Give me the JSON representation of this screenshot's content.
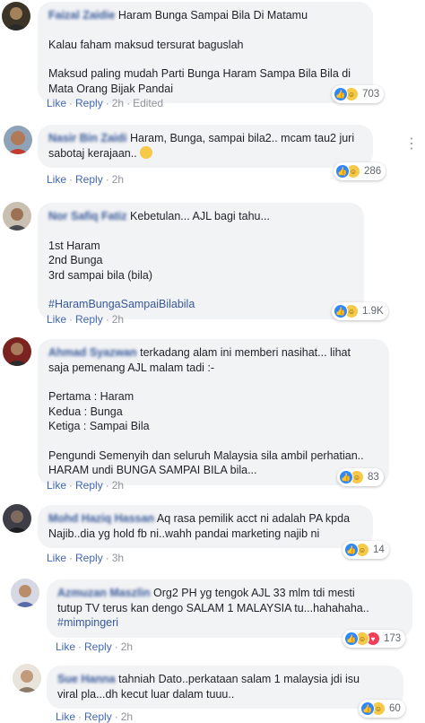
{
  "labels": {
    "like": "Like",
    "reply": "Reply",
    "separator": "·"
  },
  "colors": {
    "link": "#385898",
    "bubble": "#f2f3f5",
    "meta": "#90949c"
  },
  "comments": [
    {
      "name": "Faizal Zaidie",
      "lines": [
        "Haram Bunga Sampai Bila Di Matamu",
        "",
        "Kalau faham maksud tersurat baguslah",
        "",
        "Maksud paling mudah Parti Bunga Haram Sampa Bila Bila di",
        "Mata Orang Bijak Pandai"
      ],
      "time": "2h",
      "edited": "Edited",
      "reactions": {
        "icons": [
          "like",
          "haha"
        ],
        "count": "703"
      }
    },
    {
      "name": "Nasir Bin Zaidi",
      "lines": [
        "Haram, Bunga, sampai bila2.. mcam tau2 juri",
        "sabotaj kerajaan.."
      ],
      "emoji": "laughing-face",
      "time": "2h",
      "reactions": {
        "icons": [
          "like",
          "haha"
        ],
        "count": "286"
      }
    },
    {
      "name": "Nor Safiq Fatiz",
      "lines": [
        "Kebetulan... AJL bagi tahu...",
        "",
        "1st Haram",
        "2nd Bunga",
        "3rd sampai bila (bila)",
        ""
      ],
      "hashtag": "#HaramBungaSampaiBilabila",
      "time": "2h",
      "reactions": {
        "icons": [
          "like",
          "haha"
        ],
        "count": "1.9K"
      }
    },
    {
      "name": "Ahmad Syazwan",
      "lines": [
        "terkadang alam ini memberi nasihat... lihat",
        "saja pemenang AJL malam tadi :-",
        "",
        "Pertama : Haram",
        "Kedua : Bunga",
        "Ketiga : Sampai Bila",
        "",
        "Pengundi Semenyih dan seluruh Malaysia sila ambil perhatian..",
        "HARAM undi BUNGA SAMPAI BILA bila..."
      ],
      "time": "2h",
      "reactions": {
        "icons": [
          "like",
          "haha"
        ],
        "count": "83"
      }
    },
    {
      "name": "Mohd Haziq Hassan",
      "lines": [
        "Aq rasa pemilik acct ni adalah PA kpda",
        "Najib..dia yg hold fb ni..wahh pandai marketing najib ni"
      ],
      "time": "3h",
      "reactions": {
        "icons": [
          "like",
          "haha"
        ],
        "count": "14"
      }
    },
    {
      "name": "Azmuzan Maszlin",
      "lines": [
        "Org2 PH yg tengok AJL 33 mlm tdi mesti",
        "tutup TV terus kan dengo SALAM 1 MALAYSIA tu...hahahaha.."
      ],
      "hashtag": "#mimpingeri",
      "time": "2h",
      "reactions": {
        "icons": [
          "like",
          "haha",
          "love"
        ],
        "count": "173"
      }
    },
    {
      "name": "Sue Hanna",
      "lines": [
        "tahniah Dato..perkataan salam 1 malaysia jdi isu",
        "viral pla...dh kecut luar dalam tuuu.."
      ],
      "time": "2h",
      "reactions": {
        "icons": [
          "like",
          "haha"
        ],
        "count": "60"
      }
    }
  ]
}
